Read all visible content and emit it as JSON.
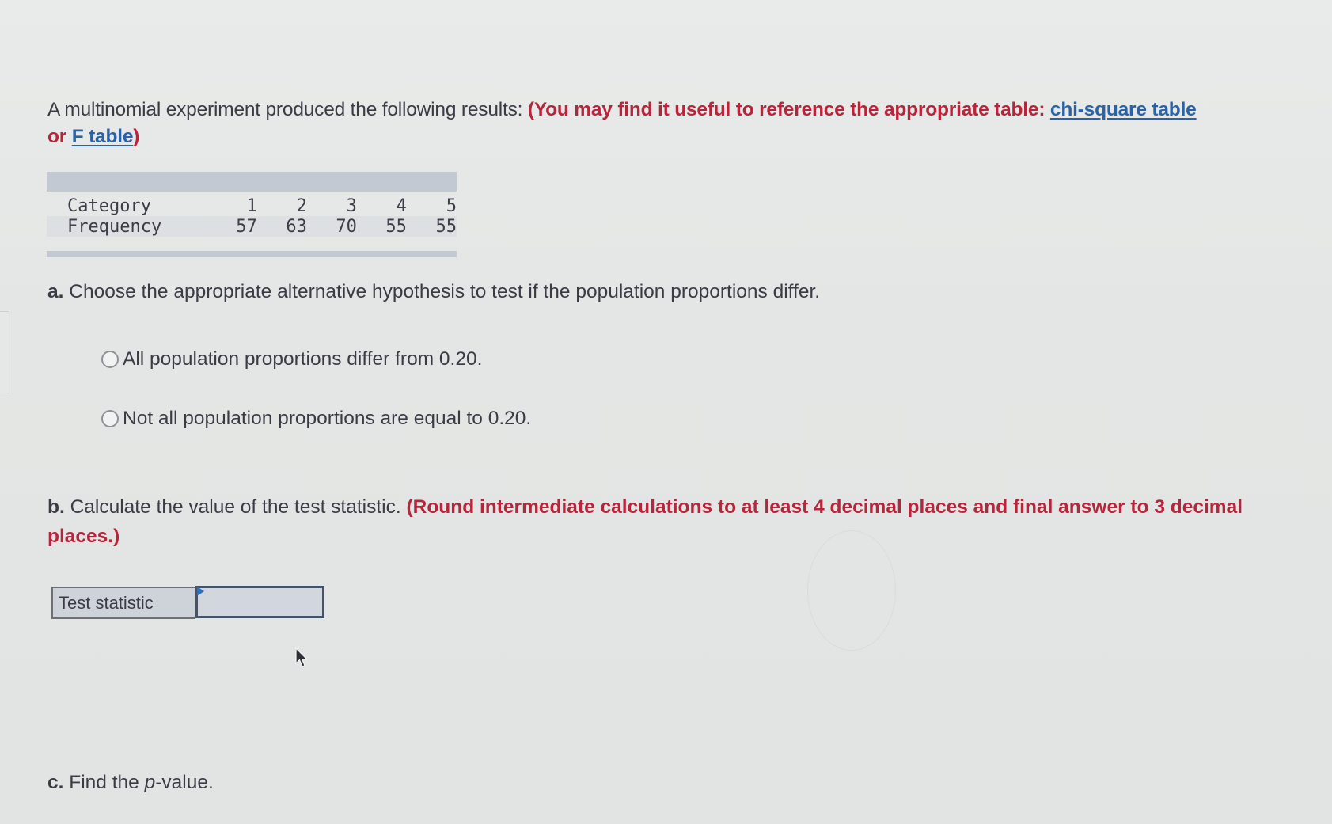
{
  "intro": {
    "text": "A multinomial experiment produced the following results: ",
    "note_prefix": "(You may find it useful to reference the appropriate table: ",
    "link_chi": "chi-square table",
    "note_mid": " or ",
    "link_f": "F table",
    "note_suffix": ")"
  },
  "table": {
    "row_labels": [
      "Category",
      "Frequency"
    ],
    "categories": [
      "1",
      "2",
      "3",
      "4",
      "5"
    ],
    "frequencies": [
      "57",
      "63",
      "70",
      "55",
      "55"
    ]
  },
  "part_a": {
    "letter": "a.",
    "text": " Choose the appropriate alternative hypothesis to test if the population proportions differ.",
    "options": [
      {
        "label": "All population proportions differ from 0.20.",
        "selected": false
      },
      {
        "label": "Not all population proportions are equal to 0.20.",
        "selected": false
      }
    ]
  },
  "part_b": {
    "letter": "b.",
    "text": " Calculate the value of the test statistic. ",
    "note": "(Round intermediate calculations to at least 4 decimal places and final answer to 3 decimal places.)",
    "field_label": "Test statistic",
    "field_value": ""
  },
  "part_c": {
    "letter": "c.",
    "text_before": " Find the ",
    "text_italic": "p",
    "text_after": "-value."
  },
  "colors": {
    "accent_red": "#b8243a",
    "link_blue": "#2a62a8",
    "table_bar": "#c3c9d3",
    "input_flag": "#2c6ec2"
  }
}
